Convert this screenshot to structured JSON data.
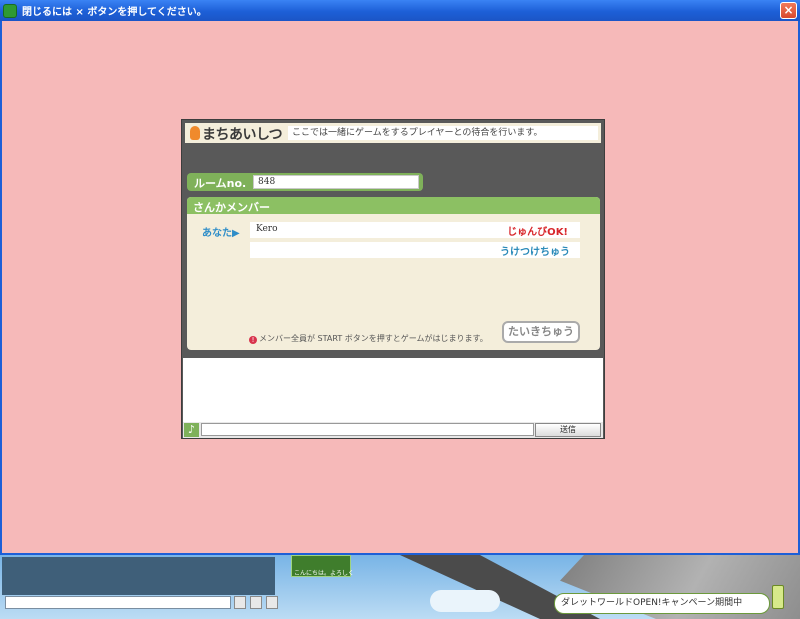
{
  "window": {
    "title": "閉じるには × ボタンを押してください。",
    "close_label": "×"
  },
  "panel": {
    "logo_text": "まちあいしつ",
    "description": "ここでは一緒にゲームをするプレイヤーとの待合を行います。",
    "room_label": "ルームno.",
    "room_number": "848",
    "members_header": "さんかメンバー",
    "you_label": "あなた",
    "members": [
      {
        "name": "Kero",
        "status": "じゅんびOK!"
      },
      {
        "name": "",
        "status": "うけつけちゅう"
      }
    ],
    "notice": "メンバー全員が START ボタンを押すとゲームがはじまります。",
    "wait_button": "たいきちゅう",
    "chat_icon": "♪",
    "send_button": "送信"
  },
  "bottom": {
    "card_text": "こんにちは。よろしく",
    "campaign": "ダレットワールドOPEN!キャンペーン期間中"
  },
  "colors": {
    "window_bg": "#f6b9b9",
    "accent_green": "#8cc063",
    "ready_red": "#d8262a",
    "accepting_blue": "#2a8ab9"
  }
}
